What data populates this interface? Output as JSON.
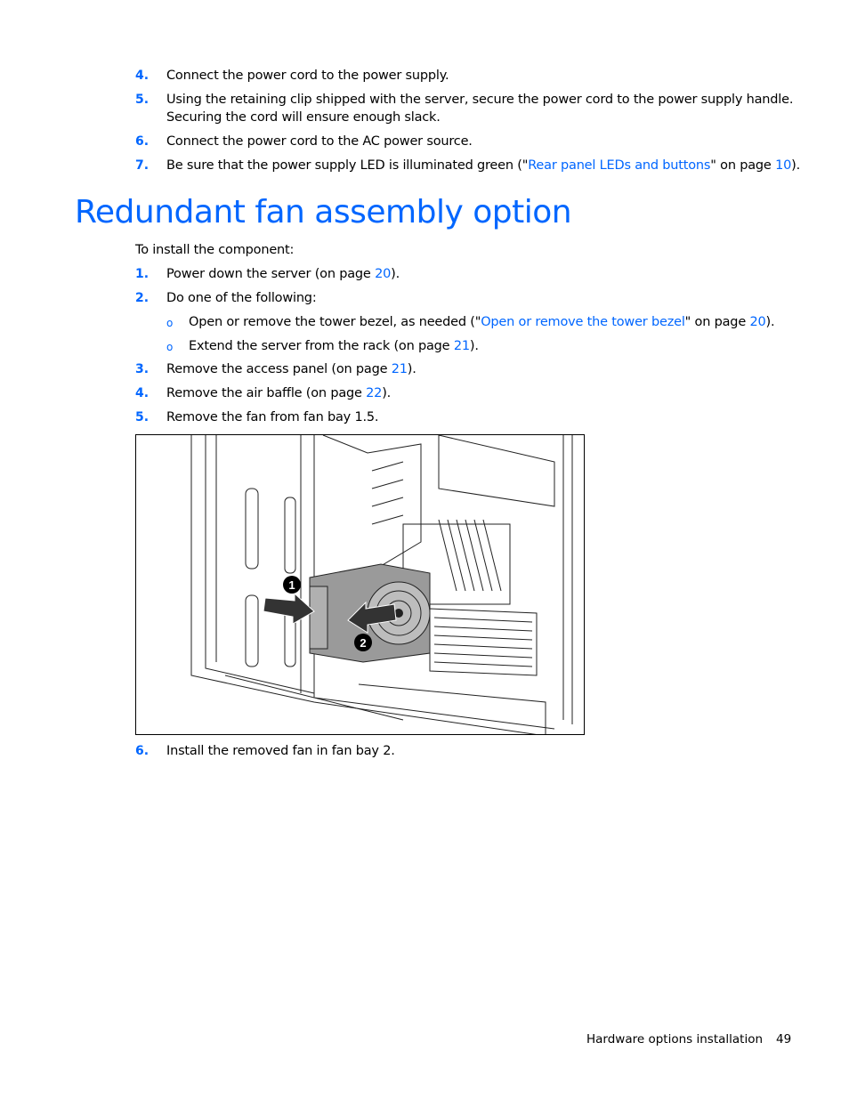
{
  "steps_top": [
    {
      "num": "4.",
      "pre": "Connect the power cord to the power supply."
    },
    {
      "num": "5.",
      "pre": "Using the retaining clip shipped with the server, secure the power cord to the power supply handle.",
      "cont": "Securing the cord will ensure enough slack."
    },
    {
      "num": "6.",
      "pre": "Connect the power cord to the AC power source."
    },
    {
      "num": "7.",
      "pre": "Be sure that the power supply LED is illuminated green (\"",
      "link": "Rear panel LEDs and buttons",
      "mid": "\" on page ",
      "page": "10",
      "post": ")."
    }
  ],
  "heading": "Redundant fan assembly option",
  "intro": "To install the component:",
  "steps": [
    {
      "num": "1.",
      "pre": "Power down the server (on page ",
      "page": "20",
      "post": ")."
    },
    {
      "num": "2.",
      "pre": "Do one of the following:"
    },
    {
      "bullet": "o",
      "pre": "Open or remove the tower bezel, as needed (\"",
      "link": "Open or remove the tower bezel",
      "mid": "\" on page ",
      "page": "20",
      "post": ")."
    },
    {
      "bullet": "o",
      "pre": "Extend the server from the rack (on page ",
      "page": "21",
      "post": ")."
    },
    {
      "num": "3.",
      "pre": "Remove the access panel (on page ",
      "page": "21",
      "post": ")."
    },
    {
      "num": "4.",
      "pre": "Remove the air baffle (on page ",
      "page": "22",
      "post": ")."
    },
    {
      "num": "5.",
      "pre": "Remove the fan from fan bay 1.5."
    }
  ],
  "figure": {
    "callouts": [
      "1",
      "2"
    ]
  },
  "step_after": {
    "num": "6.",
    "pre": "Install the removed fan in fan bay 2."
  },
  "footer": {
    "section": "Hardware options installation",
    "page": "49"
  },
  "colors": {
    "accent": "#0066ff",
    "text": "#000000"
  }
}
